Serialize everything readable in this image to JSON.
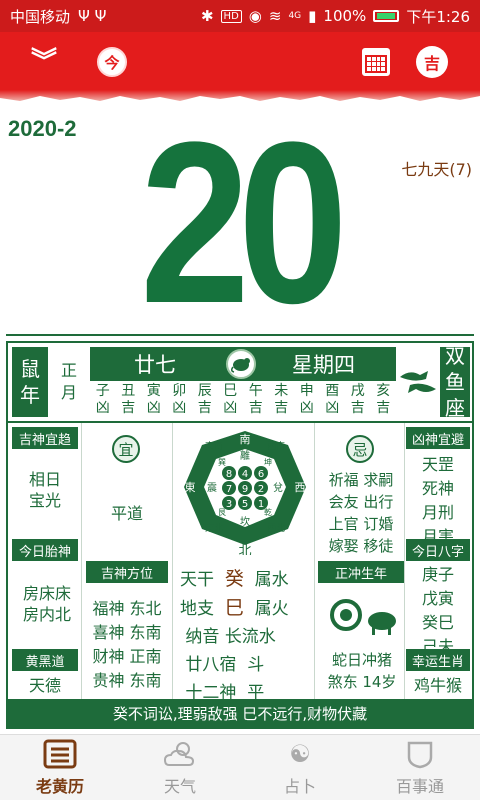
{
  "status_bar": {
    "carrier": "中国移动",
    "usb": "Ψ Ψ",
    "network": "4G",
    "battery": "100%",
    "time": "下午1:26",
    "hd": "HD"
  },
  "toolbar": {
    "today_label": "今",
    "ji_label": "吉"
  },
  "date": {
    "year_month": "2020-2",
    "day": "20",
    "jiujiu": "七九天(7)"
  },
  "almanac": {
    "year_label": [
      "鼠",
      "年"
    ],
    "month_label": [
      "正",
      "月"
    ],
    "lunar_day": "廿七",
    "weekday": "星期四",
    "hours": [
      {
        "branch": "子",
        "luck": "凶"
      },
      {
        "branch": "丑",
        "luck": "吉"
      },
      {
        "branch": "寅",
        "luck": "凶"
      },
      {
        "branch": "卯",
        "luck": "凶"
      },
      {
        "branch": "辰",
        "luck": "吉"
      },
      {
        "branch": "巳",
        "luck": "凶"
      },
      {
        "branch": "午",
        "luck": "吉"
      },
      {
        "branch": "未",
        "luck": "吉"
      },
      {
        "branch": "申",
        "luck": "凶"
      },
      {
        "branch": "酉",
        "luck": "凶"
      },
      {
        "branch": "戌",
        "luck": "吉"
      },
      {
        "branch": "亥",
        "luck": "吉"
      }
    ],
    "zodiac_label": [
      "双",
      "鱼",
      "座"
    ],
    "jishen_title": "吉神宜趋",
    "jishen": "相日\n宝光",
    "yi_badge": "宜",
    "yi": "平道",
    "ji_badge": "忌",
    "ji": [
      "祈福 求嗣",
      "会友 出行",
      "上官 订婚",
      "嫁娶 移徒"
    ],
    "xiongshen_title": "凶神宜避",
    "xiongshen": [
      "天罡",
      "死神",
      "月刑",
      "月害"
    ],
    "taishen_title": "今日胎神",
    "taishen": [
      "房床床",
      "房内北"
    ],
    "directions_title": "吉神方位",
    "directions": [
      "福神 东北",
      "喜神 东南",
      "财神 正南",
      "贵神 东南"
    ],
    "huangdao_title": "黄黑道",
    "huangdao": "天德",
    "tiangan": [
      "天干",
      "癸",
      "属水"
    ],
    "dizhi": [
      "地支",
      "巳",
      "属火"
    ],
    "nayin": [
      "纳音",
      "长流水"
    ],
    "xiu": [
      "廿八宿",
      "斗"
    ],
    "shen": [
      "十二神",
      "平"
    ],
    "chong_title": "正冲生年",
    "chong": [
      "蛇日冲猪",
      "煞东 14岁"
    ],
    "bazi_title": "今日八字",
    "bazi": [
      "庚子",
      "戊寅",
      "癸巳",
      "己未"
    ],
    "lucky_title": "幸运生肖",
    "lucky": "鸡牛猴",
    "bagua": {
      "south": "南",
      "north": "北",
      "east": "東",
      "west": "西",
      "se": "東南",
      "sw": "西南",
      "ne": "東北",
      "nw": "西北",
      "li": "離",
      "kan": "坎",
      "zhen": "震",
      "dui": "兌",
      "xun": "巽",
      "kun": "坤",
      "gen": "艮",
      "qian": "乾",
      "numbers": [
        "8",
        "4",
        "6",
        "7",
        "9",
        "2",
        "3",
        "5",
        "1"
      ]
    },
    "bottom_text": "癸不词讼,理弱敌强   巳不远行,财物伏藏"
  },
  "bottom_nav": [
    {
      "label": "老黄历",
      "icon": "almanac-icon",
      "active": true
    },
    {
      "label": "天气",
      "icon": "weather-icon",
      "active": false
    },
    {
      "label": "占卜",
      "icon": "yin-yang-icon",
      "active": false
    },
    {
      "label": "百事通",
      "icon": "shield-icon",
      "active": false
    }
  ],
  "colors": {
    "brand_red": "#e31c1c",
    "almanac_green": "#1e6b3a",
    "accent_brown": "#7a3b12"
  }
}
